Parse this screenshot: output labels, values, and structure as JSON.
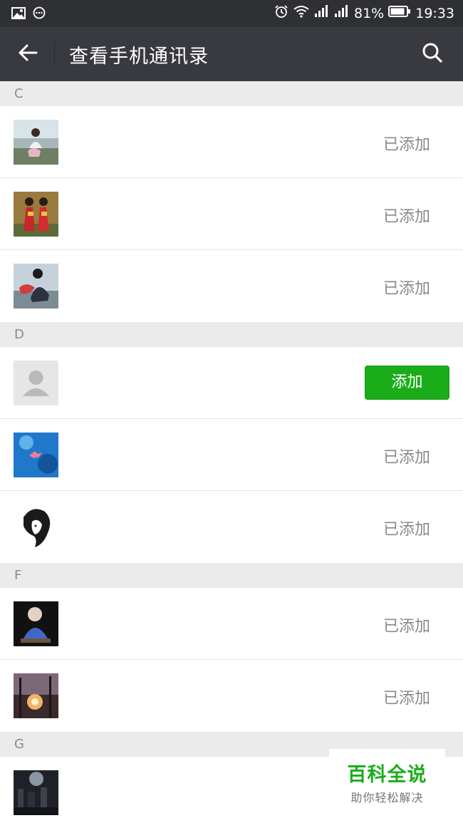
{
  "status_bar": {
    "battery": "81%",
    "time": "19:33"
  },
  "header": {
    "title": "查看手机通讯录"
  },
  "sections": [
    {
      "letter": "C",
      "contacts": [
        {
          "avatar": "outdoor-person-photo",
          "status": "已添加"
        },
        {
          "avatar": "wedding-couple-photo",
          "status": "已添加"
        },
        {
          "avatar": "person-with-flowers-photo",
          "status": "已添加"
        }
      ]
    },
    {
      "letter": "D",
      "contacts": [
        {
          "avatar": "default-person-placeholder",
          "action": "添加"
        },
        {
          "avatar": "blue-water-lotus-photo",
          "status": "已添加"
        },
        {
          "avatar": "ink-sketch-face-drawing",
          "status": "已添加"
        }
      ]
    },
    {
      "letter": "F",
      "contacts": [
        {
          "avatar": "monk-figurine-photo",
          "status": "已添加"
        },
        {
          "avatar": "sunset-trees-photo",
          "status": "已添加"
        }
      ]
    },
    {
      "letter": "G",
      "contacts": [
        {
          "avatar": "night-scene-photo",
          "status": ""
        }
      ]
    }
  ],
  "watermark": {
    "title": "百科全说",
    "subtitle": "助你轻松解决"
  },
  "colors": {
    "status_bar": "#2f3033",
    "title_bar": "#393a3f",
    "section_header": "#ebebeb",
    "add_button": "#1aad19",
    "added_text": "#888888"
  }
}
